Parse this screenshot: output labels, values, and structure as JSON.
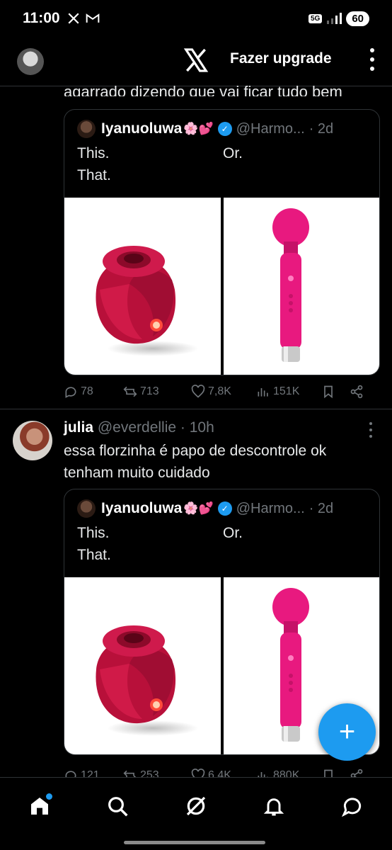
{
  "status_bar": {
    "time": "11:00",
    "network": "5G",
    "battery": "60"
  },
  "app_bar": {
    "upgrade_label": "Fazer upgrade"
  },
  "previous_tweet": {
    "text_fragment": "agarrado dizendo que vai ficar tudo bem",
    "quote": {
      "name": "Iyanuoluwa",
      "emoji": "🌸💕",
      "handle": "@Harmo...",
      "time": "· 2d",
      "line1": "This.",
      "line2": "That.",
      "or": "Or."
    },
    "actions": {
      "replies": "78",
      "reposts": "713",
      "likes": "7,8K",
      "views": "151K"
    }
  },
  "tweet": {
    "name": "julia",
    "handle": "@everdellie",
    "time": "· 10h",
    "text": "essa florzinha é papo de descontrole ok tenham muito cuidado",
    "quote": {
      "name": "Iyanuoluwa",
      "emoji": "🌸💕",
      "handle": "@Harmo...",
      "time": "· 2d",
      "line1": "This.",
      "line2": "That.",
      "or": "Or."
    },
    "actions": {
      "replies": "121",
      "reposts": "253",
      "likes": "6,4K",
      "views": "880K"
    }
  },
  "colors": {
    "background": "#000000",
    "accent": "#1d9bf0",
    "muted": "#71767b",
    "border": "#2f3336",
    "product_pink": "#e8197f"
  },
  "icons": {
    "nav": [
      "home-icon",
      "search-icon",
      "grok-icon",
      "notifications-icon",
      "messages-icon"
    ],
    "fab": "compose-plus-icon"
  },
  "fab_label": "+"
}
